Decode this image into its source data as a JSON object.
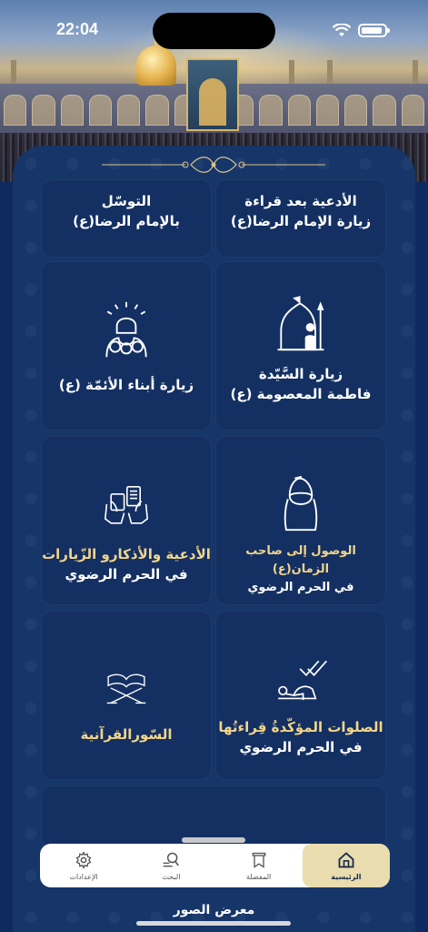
{
  "status_bar": {
    "time": "22:04"
  },
  "cards": [
    {
      "id": "supplications-after-ziyarah",
      "line1": "الأدعية بعد قراءة",
      "line2": "زيارة الإمام الرضا(ع)"
    },
    {
      "id": "tawassul",
      "line1": "التوسّل",
      "line2": "بالإمام الرضا(ع)"
    },
    {
      "id": "ziyarah-masumah",
      "line1": "زيارة السَّيّدة",
      "line2": "فاطمة المعصومة (ع)"
    },
    {
      "id": "ziyarah-sons-of-imams",
      "line1": "زيارة أبناء الأئمّة (ع)",
      "line2": ""
    },
    {
      "id": "reaching-imam-zaman",
      "line1": "الوصول إلى صاحب الزمان(ع)",
      "line2": "في الحرم الرضوي"
    },
    {
      "id": "supplications-adhkar",
      "line1": "الأدعية والأذكارو الزّيارات",
      "line2": "في الحرم الرضوي"
    },
    {
      "id": "recommended-prayers",
      "line1": "الصلوات المؤكّدةُ قِراءتُها",
      "line2": "في الحرم الرضوي"
    },
    {
      "id": "quranic-surahs",
      "line1": "السّورالقرآنية",
      "line2": ""
    }
  ],
  "tabbar": {
    "tabs": [
      {
        "id": "home",
        "label": "الرئيسية",
        "icon": "home-icon",
        "active": true
      },
      {
        "id": "favorites",
        "label": "المفضلة",
        "icon": "bookmark-icon",
        "active": false
      },
      {
        "id": "search",
        "label": "البحث",
        "icon": "search-icon",
        "active": false
      },
      {
        "id": "settings",
        "label": "الإعدادات",
        "icon": "gear-icon",
        "active": false
      }
    ]
  },
  "bottom": {
    "gallery_label": "معرض الصور"
  },
  "colors": {
    "panel": "#163569",
    "card": "#143062",
    "accent_gold": "#e9dcae",
    "title_gold": "#f3d58a"
  }
}
